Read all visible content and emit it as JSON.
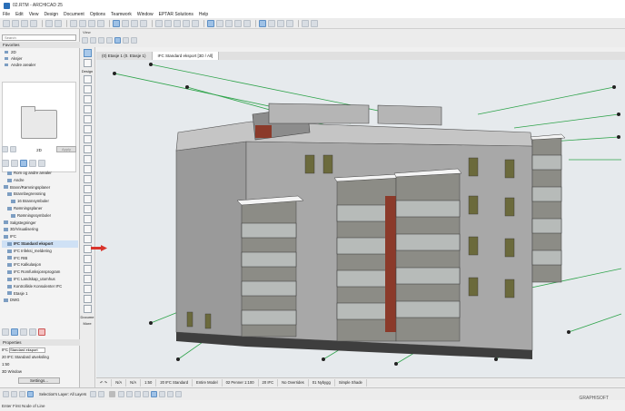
{
  "window": {
    "title": "02.RTM - ARCHICAD 25"
  },
  "menu": [
    "File",
    "Edit",
    "View",
    "Design",
    "Document",
    "Options",
    "Teamwork",
    "Window",
    "EPTAR Solutions",
    "Help"
  ],
  "view_label": "View",
  "design_label": "Design",
  "document_label": "Docume",
  "more_label": "More",
  "search_placeholder": "Search",
  "favorites": {
    "header": "Favorites",
    "items": [
      "2D",
      "Aksjer",
      "Andre arealer"
    ]
  },
  "preview_caption": "2D",
  "apply_label": "Apply",
  "tree": [
    {
      "label": "Rom og andre arealer",
      "sel": false
    },
    {
      "label": "Andre",
      "sel": false
    },
    {
      "label": "Brann/Rømningsplaner",
      "sel": false
    },
    {
      "label": "Brannbegrensning",
      "sel": false
    },
    {
      "label": "16 Brannsymboler",
      "sel": false
    },
    {
      "label": "Rømningsplaner",
      "sel": false
    },
    {
      "label": "Rømningssymboler",
      "sel": false
    },
    {
      "label": "Salgstegninger",
      "sel": false
    },
    {
      "label": "3D/Visualisering",
      "sel": false
    },
    {
      "label": "IFC",
      "sel": false
    },
    {
      "label": "IFC Standard eksport",
      "sel": true
    },
    {
      "label": "IFC Infeksi_meldering",
      "sel": false
    },
    {
      "label": "IFC RIB",
      "sel": false
    },
    {
      "label": "IFC Kalkulasjon",
      "sel": false
    },
    {
      "label": "IFC Romfunksjonsprogram",
      "sel": false
    },
    {
      "label": "IFC Landskap_utomhus",
      "sel": false
    },
    {
      "label": "Kontrollisle Konsulenter IFC",
      "sel": false
    },
    {
      "label": "Etasje 1",
      "sel": false
    },
    {
      "label": "DWG",
      "sel": false
    }
  ],
  "properties": {
    "header": "Properties",
    "ifc_label": "IFC",
    "ifc_value": "Standard eksport",
    "row2": "20 IFC Standard utveksling",
    "row3": "1:50",
    "row4": "3D Window",
    "settings": "Settings..."
  },
  "tabs": [
    "(0) Etasje 1 (0. Etasje 1)",
    "IFC Standard eksport [3D / All]"
  ],
  "status": [
    "1:50",
    "20 IFC Standard",
    "Entire Model",
    "02 Penner 1:100",
    "20 IFC",
    "No Overrides",
    "01 Nybygg",
    "Simple Shade"
  ],
  "bottom": {
    "selection_label": "Selection's Layer: All Layers",
    "graphisoft": "GRAPHISOFT",
    "hint": "Enter First Node of Line"
  },
  "colors": {
    "selected_row": "#cfe1f5",
    "accent": "#5a8fc4",
    "arrow": "#d9342b"
  }
}
